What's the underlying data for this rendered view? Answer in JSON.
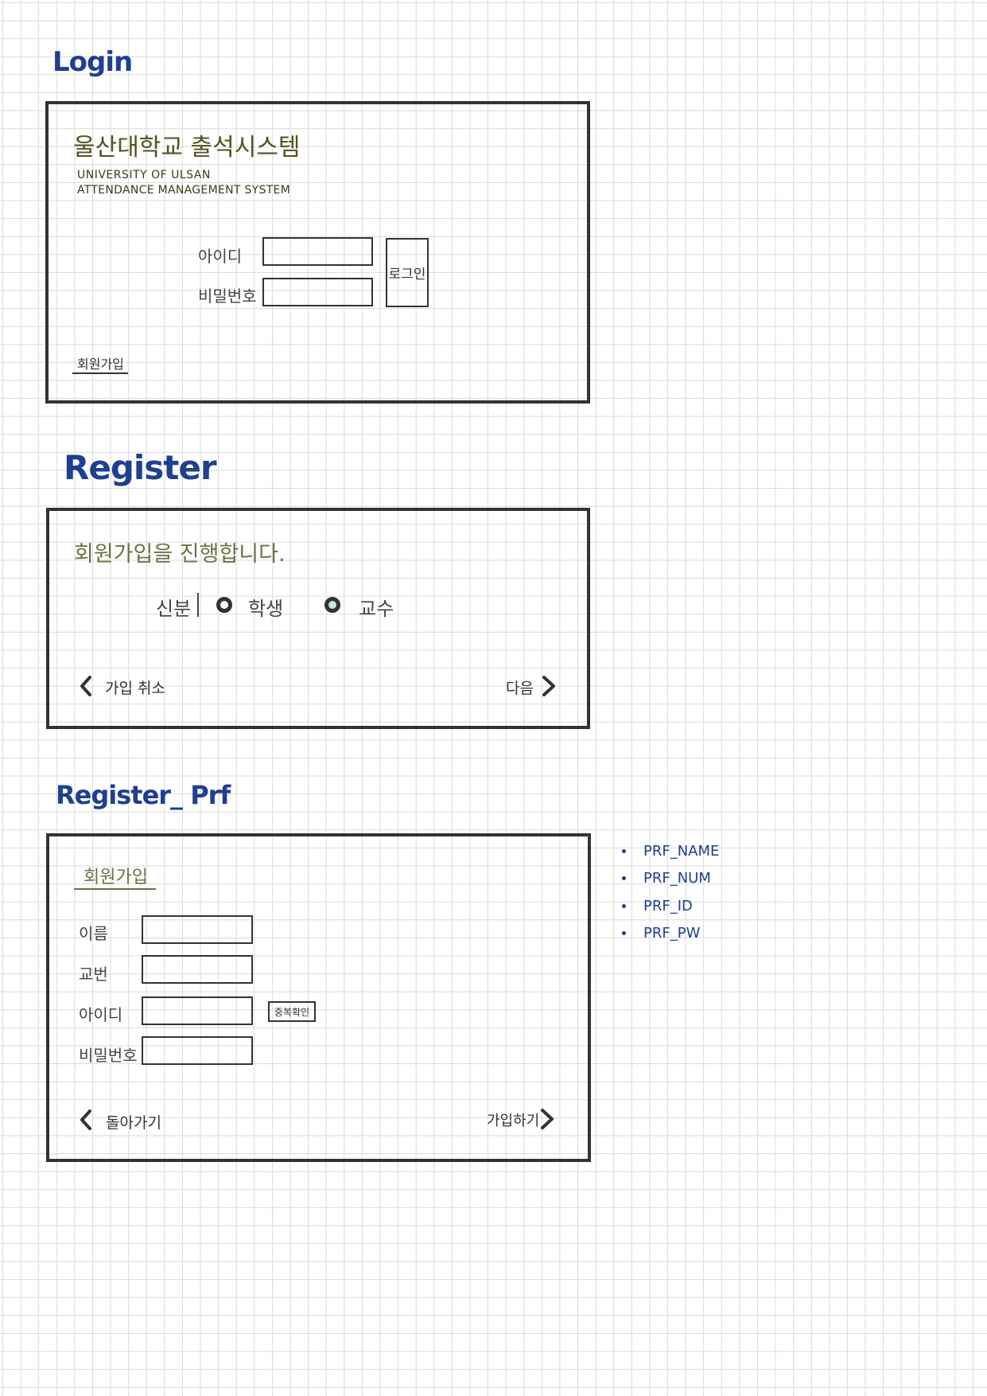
{
  "login": {
    "heading": "Login",
    "title_kr": "울산대학교 출석시스템",
    "subtitle_line1": "UNIVERSITY OF ULSAN",
    "subtitle_line2": "ATTENDANCE MANAGEMENT SYSTEM",
    "id_label": "아이디",
    "password_label": "비밀번호",
    "login_button": "로그인",
    "signup_link": "회원가입"
  },
  "register": {
    "heading": "Register",
    "intro": "회원가입을 진행합니다.",
    "role_label": "신분",
    "options": [
      "학생",
      "교수"
    ],
    "cancel_label": "가입 취소",
    "next_label": "다음"
  },
  "register_prf": {
    "heading": "Register_ Prf",
    "form_title": "회원가입",
    "fields": [
      "이름",
      "교번",
      "아이디",
      "비밀번호"
    ],
    "dup_check_button": "중복확인",
    "back_label": "돌아가기",
    "submit_label": "가입하기"
  },
  "notes": {
    "items": [
      "PRF_NAME",
      "PRF_NUM",
      "PRF_ID",
      "PRF_PW"
    ]
  },
  "colors": {
    "heading": "#1f3f8f",
    "title_kr": "#55521c",
    "intro": "#6a7344",
    "radio_selected": "#cfe6d2"
  }
}
